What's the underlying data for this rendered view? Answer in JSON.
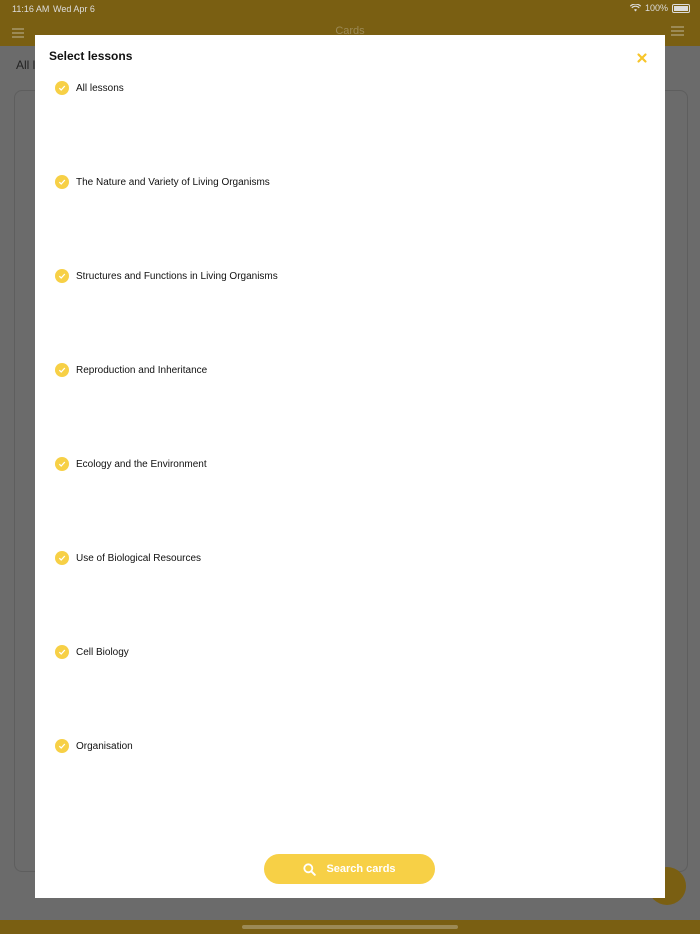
{
  "status_bar": {
    "time": "11:16 AM",
    "date": "Wed Apr 6",
    "battery": "100%"
  },
  "nav": {
    "title": "Cards"
  },
  "background": {
    "label": "All l"
  },
  "modal": {
    "title": "Select lessons",
    "lessons": [
      {
        "label": "All lessons",
        "checked": true
      },
      {
        "label": "The Nature and Variety of Living Organisms",
        "checked": true
      },
      {
        "label": "Structures and Functions in Living Organisms",
        "checked": true
      },
      {
        "label": "Reproduction and Inheritance",
        "checked": true
      },
      {
        "label": "Ecology and the Environment",
        "checked": true
      },
      {
        "label": "Use of Biological Resources",
        "checked": true
      },
      {
        "label": "Cell Biology",
        "checked": true
      },
      {
        "label": "Organisation",
        "checked": true
      }
    ],
    "search_button": {
      "label": "Search cards",
      "icon": "search-icon"
    }
  },
  "colors": {
    "accent": "#f7d046",
    "overlay": "#6b6b6b",
    "nav_dim": "#7a5f12"
  }
}
